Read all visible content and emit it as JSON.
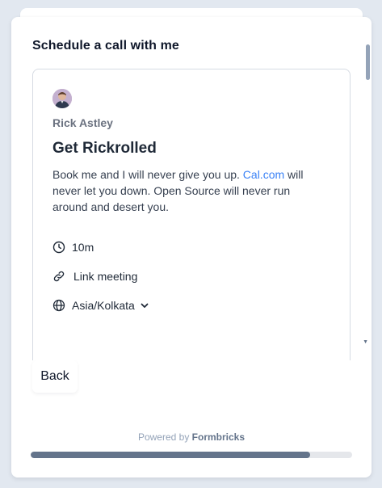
{
  "survey": {
    "question_title": "Schedule a call with me",
    "back_label": "Back",
    "progress": 0.87,
    "footer": {
      "powered_by_prefix": "Powered by",
      "brand": "Formbricks"
    }
  },
  "booking": {
    "host_name": "Rick Astley",
    "event_title": "Get Rickrolled",
    "description_before_link": "Book me and I will never give you up.",
    "description_link": "Cal.com",
    "description_after_link": "will never let you down. Open Source will never run around and desert you.",
    "duration": "10m",
    "location": "Link meeting",
    "timezone": "Asia/Kolkata"
  },
  "icons": {
    "duration": "clock-icon",
    "location": "link-icon",
    "timezone": "globe-icon",
    "dropdown": "chevron-down-icon"
  },
  "colors": {
    "link": "#3b82f6",
    "progress_fill": "#64748b",
    "progress_track": "#e5e7eb",
    "background": "#e2e8f0"
  }
}
